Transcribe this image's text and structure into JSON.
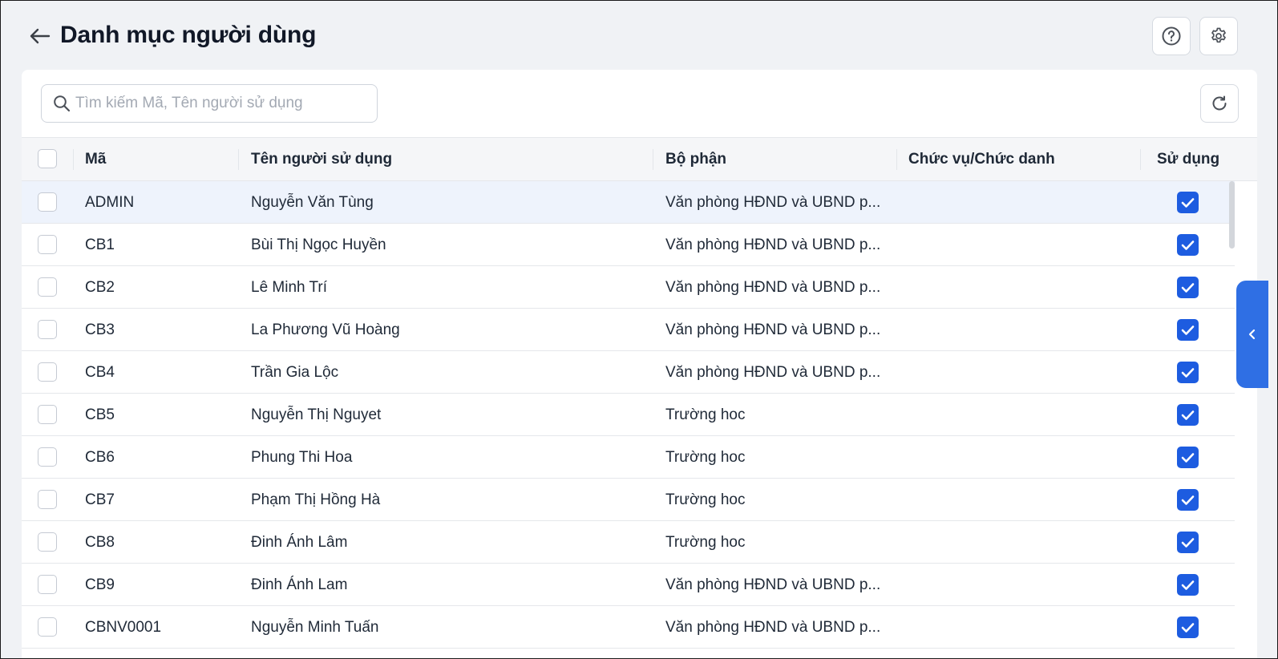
{
  "header": {
    "title": "Danh mục người dùng",
    "back_icon": "arrow-left-icon",
    "help_icon": "question-circle-icon",
    "settings_icon": "gear-icon"
  },
  "search": {
    "placeholder": "Tìm kiếm Mã, Tên người sử dụng",
    "value": ""
  },
  "toolbar": {
    "refresh_icon": "refresh-icon"
  },
  "table": {
    "columns": {
      "code": "Mã",
      "name": "Tên người sử dụng",
      "department": "Bộ phận",
      "position": "Chức vụ/Chức danh",
      "active": "Sử dụng"
    },
    "rows": [
      {
        "code": "ADMIN",
        "name": "Nguyễn Văn Tùng",
        "department": "Văn phòng HĐND và UBND p...",
        "position": "",
        "active": true,
        "selected": true
      },
      {
        "code": "CB1",
        "name": "Bùi Thị Ngọc Huyền",
        "department": "Văn phòng HĐND và UBND p...",
        "position": "",
        "active": true
      },
      {
        "code": "CB2",
        "name": "Lê Minh Trí",
        "department": "Văn phòng HĐND và UBND p...",
        "position": "",
        "active": true
      },
      {
        "code": "CB3",
        "name": "La Phương Vũ Hoàng",
        "department": "Văn phòng HĐND và UBND p...",
        "position": "",
        "active": true
      },
      {
        "code": "CB4",
        "name": "Trần Gia Lộc",
        "department": "Văn phòng HĐND và UBND p...",
        "position": "",
        "active": true
      },
      {
        "code": "CB5",
        "name": "Nguyễn Thị Nguyet",
        "department": "Trường hoc",
        "position": "",
        "active": true
      },
      {
        "code": "CB6",
        "name": "Phung Thi Hoa",
        "department": "Trường hoc",
        "position": "",
        "active": true
      },
      {
        "code": "CB7",
        "name": "Phạm Thị Hồng Hà",
        "department": "Trường hoc",
        "position": "",
        "active": true
      },
      {
        "code": "CB8",
        "name": "Đinh Ánh Lâm",
        "department": "Trường hoc",
        "position": "",
        "active": true
      },
      {
        "code": "CB9",
        "name": "Đinh Ánh Lam",
        "department": "Văn phòng HĐND và UBND p...",
        "position": "",
        "active": true
      },
      {
        "code": "CBNV0001",
        "name": "Nguyễn Minh Tuấn",
        "department": "Văn phòng HĐND và UBND p...",
        "position": "",
        "active": true
      }
    ]
  },
  "side_panel": {
    "toggle_icon": "chevron-left-icon"
  },
  "colors": {
    "accent": "#1d5ce0",
    "side_tab": "#2f6fe4",
    "selected_row": "#eef3fc",
    "page_bg": "#f0f2f5"
  }
}
